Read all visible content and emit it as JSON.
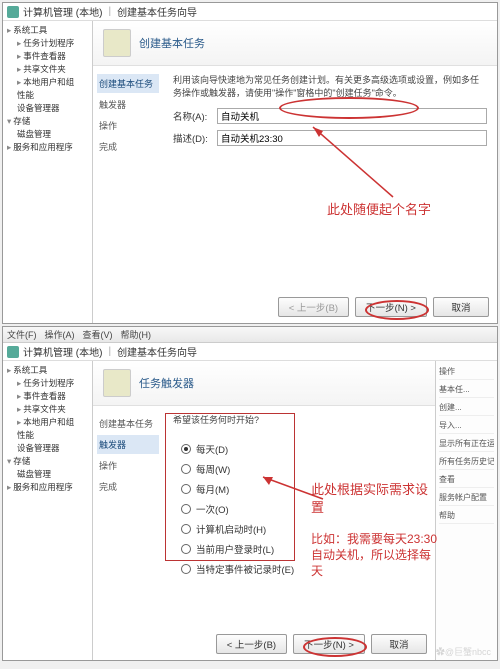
{
  "top": {
    "title": "计算机管理 (本地)",
    "wizardTab": "创建基本任务向导",
    "tree": {
      "n1": "系统工具",
      "n2": "任务计划程序",
      "n3": "事件查看器",
      "n4": "共享文件夹",
      "n5": "本地用户和组",
      "n6": "性能",
      "n7": "设备管理器",
      "n8": "存储",
      "n9": "磁盘管理",
      "n10": "服务和应用程序"
    },
    "wizHeader": "创建基本任务",
    "steps": {
      "s1": "创建基本任务",
      "s2": "触发器",
      "s3": "操作",
      "s4": "完成"
    },
    "desc": "利用该向导快速地为常见任务创建计划。有关更多高级选项或设置，例如多任务操作或触发器，请使用\"操作\"窗格中的\"创建任务\"命令。",
    "nameLabel": "名称(A):",
    "nameValue": "自动关机",
    "descLabel": "描述(D):",
    "descValue": "自动关机23:30",
    "buttons": {
      "back": "< 上一步(B)",
      "next": "下一步(N) >",
      "cancel": "取消"
    },
    "annotation": "此处随便起个名字"
  },
  "bottom": {
    "menu": {
      "m1": "文件(F)",
      "m2": "操作(A)",
      "m3": "查看(V)",
      "m4": "帮助(H)"
    },
    "title": "计算机管理 (本地)",
    "wizardTab": "创建基本任务向导",
    "wizHeader": "任务触发器",
    "steps": {
      "s1": "创建基本任务",
      "s2": "触发器",
      "s3": "操作",
      "s4": "完成"
    },
    "prompt": "希望该任务何时开始?",
    "opts": {
      "o1": "每天(D)",
      "o2": "每周(W)",
      "o3": "每月(M)",
      "o4": "一次(O)",
      "o5": "计算机启动时(H)",
      "o6": "当前用户登录时(L)",
      "o7": "当特定事件被记录时(E)"
    },
    "buttons": {
      "back": "< 上一步(B)",
      "next": "下一步(N) >",
      "cancel": "取消"
    },
    "annotation1": "此处根据实际需求设置",
    "annotation2": "比如：我需要每天23:30自动关机，所以选择每天",
    "right": {
      "r1": "操作",
      "r2": "基本任...",
      "r3": "创建...",
      "r4": "导入...",
      "r5": "显示所有正在运行...",
      "r6": "所有任务历史记录",
      "r7": "查看",
      "r8": "服务帐户配置",
      "r9": "帮助"
    }
  },
  "watermark": "✿@巨蟹nbcc"
}
